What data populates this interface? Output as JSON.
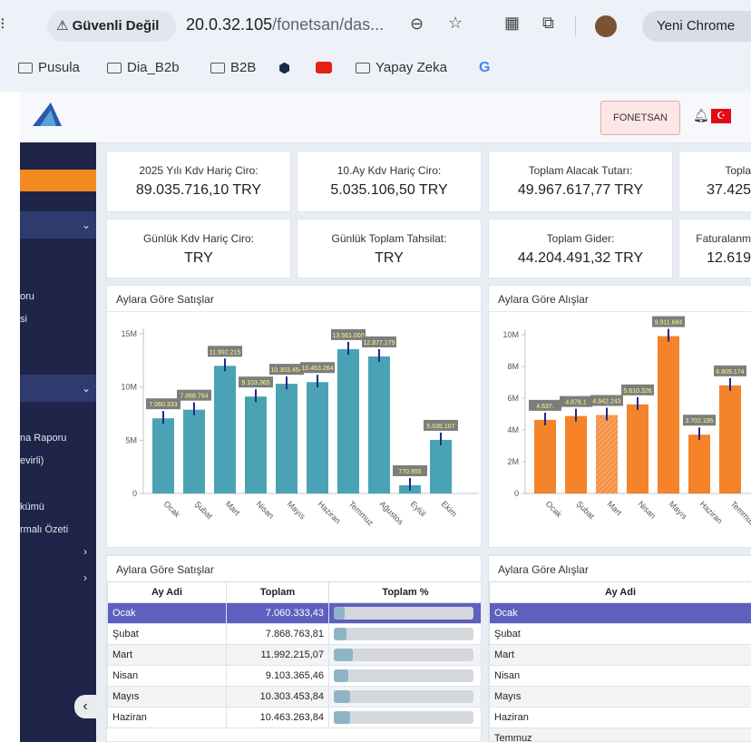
{
  "browser": {
    "warning": "Güvenli Değil",
    "url_host": "20.0.32.105",
    "url_path": "/fonetsan/das...",
    "new_chrome": "Yeni Chrome",
    "bookmarks": [
      "Pusula",
      "Dia_B2b",
      "B2B",
      "Yapay Zeka"
    ]
  },
  "header": {
    "company": "FONETSAN"
  },
  "sidebar": {
    "items": [
      "oru",
      "si",
      "na Raporu",
      "evirli)",
      "kümü",
      "rmalı Özeti"
    ]
  },
  "cards": [
    {
      "label": "2025 Yılı Kdv Hariç Ciro:",
      "value": "89.035.716,10 TRY"
    },
    {
      "label": "10.Ay Kdv Hariç Ciro:",
      "value": "5.035.106,50 TRY"
    },
    {
      "label": "Toplam Alacak Tutarı:",
      "value": "49.967.617,77 TRY"
    },
    {
      "label": "Topla",
      "value": "37.425"
    },
    {
      "label": "Günlük Kdv Hariç Ciro:",
      "value": "TRY"
    },
    {
      "label": "Günlük Toplam Tahsilat:",
      "value": "TRY"
    },
    {
      "label": "Toplam Gider:",
      "value": "44.204.491,32 TRY"
    },
    {
      "label": "Faturalanm",
      "value": "12.619"
    }
  ],
  "chart_data": [
    {
      "type": "bar",
      "title": "Aylara Göre Satışlar",
      "categories": [
        "Ocak",
        "Şubat",
        "Mart",
        "Nisan",
        "Mayıs",
        "Haziran",
        "Temmuz",
        "Ağustos",
        "Eylül",
        "Ekim"
      ],
      "values": [
        7060333,
        7868764,
        11992215,
        9103365,
        10303454,
        10463264,
        13561000,
        12877179,
        770955,
        5035107
      ],
      "data_labels": [
        "7.060.333",
        "7.868.764",
        "11.992.215",
        "9.103.365",
        "10.303.454",
        "10.463.264",
        "13.561.000",
        "12.877.179",
        "770.955",
        "5.035.107"
      ],
      "y_ticks": [
        "0",
        "5M",
        "10M",
        "15M"
      ],
      "ylim": [
        0,
        15000000
      ],
      "color": "#4aa3b4"
    },
    {
      "type": "bar",
      "title": "Aylara Göre Alışlar",
      "categories": [
        "Ocak",
        "Şubat",
        "Mart",
        "Nisan",
        "Mayıs",
        "Haziran",
        "Temmuz"
      ],
      "values": [
        4637000,
        4878000,
        4942243,
        5610326,
        9911684,
        3702195,
        6809174
      ],
      "data_labels": [
        "4.637.",
        "4.878.1",
        "4.942.243",
        "5.610.326",
        "9.911.684",
        "3.702.195",
        "6.809.174"
      ],
      "y_ticks": [
        "0",
        "2M",
        "4M",
        "6M",
        "8M",
        "10M"
      ],
      "ylim": [
        0,
        10000000
      ],
      "color": "#f5832a"
    }
  ],
  "sales_table": {
    "title": "Aylara Göre Satışlar",
    "headers": [
      "Ay Adi",
      "Toplam",
      "Toplam %"
    ],
    "rows": [
      {
        "month": "Ocak",
        "total": "7.060.333,43",
        "pct": 7.9
      },
      {
        "month": "Şubat",
        "total": "7.868.763,81",
        "pct": 8.8
      },
      {
        "month": "Mart",
        "total": "11.992.215,07",
        "pct": 13.5
      },
      {
        "month": "Nisan",
        "total": "9.103.365,46",
        "pct": 10.2
      },
      {
        "month": "Mayıs",
        "total": "10.303.453,84",
        "pct": 11.6
      },
      {
        "month": "Haziran",
        "total": "10.463.263,84",
        "pct": 11.8
      }
    ]
  },
  "purchase_table": {
    "title": "Aylara Göre Alışlar",
    "headers": [
      "Ay Adi"
    ],
    "rows": [
      "Ocak",
      "Şubat",
      "Mart",
      "Nisan",
      "Mayıs",
      "Haziran",
      "Temmuz"
    ]
  }
}
